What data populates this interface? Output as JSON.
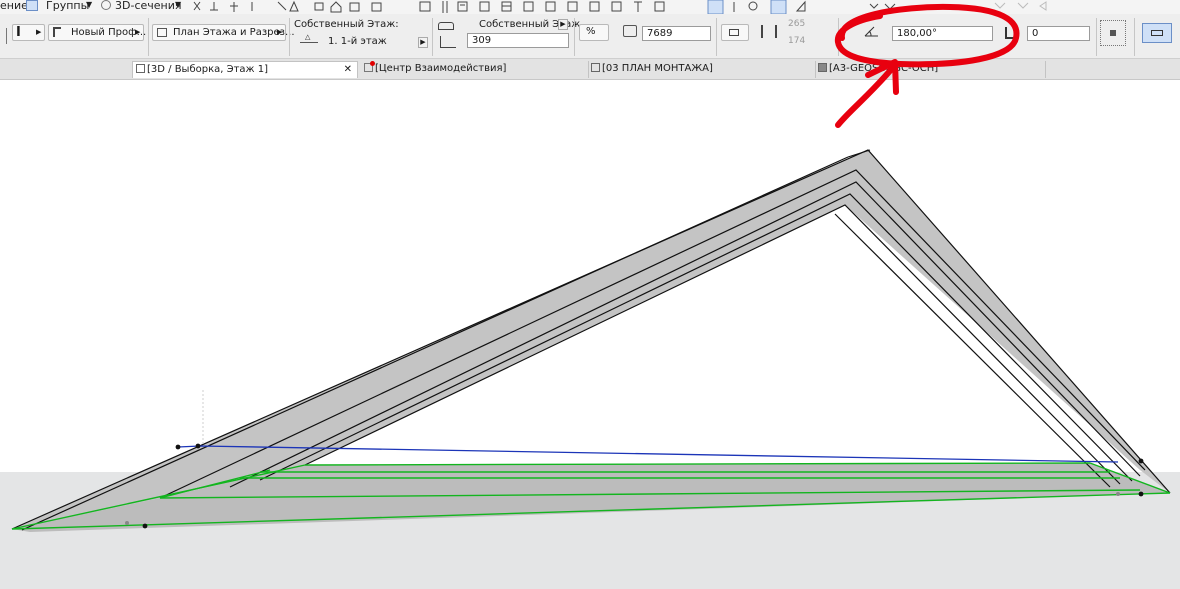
{
  "toolbar_top": {
    "partial_label": "ение",
    "groups_label": "Группы",
    "sections_label": "3D-сечения"
  },
  "info_box": {
    "profile_label": "Новый Проф...",
    "floor_plan_label": "План Этажа и Разрез...",
    "home_story_label": "Собственный Этаж:",
    "home_story_value": "1. 1-й этаж",
    "home_story2_label": "Собственный Этаж",
    "offset_value": "309",
    "length_value": "7689",
    "dim_top": "265",
    "dim_bottom": "174",
    "angle_value": "180,00°",
    "right_value": "0"
  },
  "tabs": [
    {
      "label": "[3D / Выборка, Этаж 1]",
      "active": true
    },
    {
      "label": "[Центр Взаимодействия]",
      "active": false
    },
    {
      "label": "[03 ПЛАН МОНТАЖА]",
      "active": false
    },
    {
      "label": "[A3-GEOSCOGC-OCH]",
      "active": false
    }
  ],
  "colors": {
    "annotation": "#e8000f",
    "selection_green": "#13b51f",
    "selection_blue": "#1c35b8",
    "roof_fill": "#c4c4c4",
    "ground": "#e4e5e6"
  },
  "icons": {
    "close": "close-icon",
    "annotation": "red-circle-arrow-annotation"
  }
}
